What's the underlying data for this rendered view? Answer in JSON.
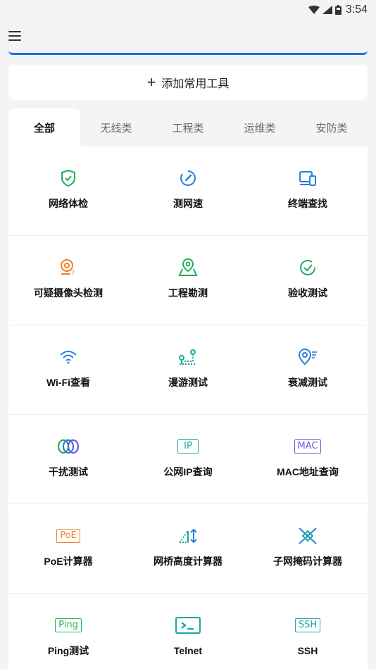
{
  "status_bar": {
    "time": "3:54"
  },
  "add_tool": {
    "plus": "+",
    "label": "添加常用工具"
  },
  "tabs": [
    {
      "label": "全部"
    },
    {
      "label": "无线类"
    },
    {
      "label": "工程类"
    },
    {
      "label": "运维类"
    },
    {
      "label": "安防类"
    }
  ],
  "tools": [
    {
      "label": "网络体检",
      "icon": "shield-check-icon"
    },
    {
      "label": "测网速",
      "icon": "speedometer-icon"
    },
    {
      "label": "终端查找",
      "icon": "device-search-icon"
    },
    {
      "label": "可疑摄像头检测",
      "icon": "camera-question-icon"
    },
    {
      "label": "工程勘测",
      "icon": "location-survey-icon"
    },
    {
      "label": "验收测试",
      "icon": "check-circle-icon"
    },
    {
      "label": "Wi-Fi查看",
      "icon": "wifi-icon"
    },
    {
      "label": "漫游测试",
      "icon": "roaming-icon"
    },
    {
      "label": "衰减测试",
      "icon": "attenuation-icon"
    },
    {
      "label": "干扰测试",
      "icon": "interference-icon"
    },
    {
      "label": "公网IP查询",
      "icon": "ip-box-icon",
      "badge": "IP"
    },
    {
      "label": "MAC地址查询",
      "icon": "mac-box-icon",
      "badge": "MAC"
    },
    {
      "label": "PoE计算器",
      "icon": "poe-box-icon",
      "badge": "PoE"
    },
    {
      "label": "网桥高度计算器",
      "icon": "bridge-height-icon"
    },
    {
      "label": "子网掩码计算器",
      "icon": "subnet-mask-icon"
    },
    {
      "label": "Ping测试",
      "icon": "ping-box-icon",
      "badge": "Ping"
    },
    {
      "label": "Telnet",
      "icon": "terminal-icon"
    },
    {
      "label": "SSH",
      "icon": "ssh-box-icon",
      "badge": "SSH"
    }
  ],
  "colors": {
    "accent": "#1e6fd8",
    "green": "#1fae5b",
    "blue": "#2a7de1",
    "orange": "#f0802a",
    "purple": "#6b5bd6",
    "teal": "#1aa7a0"
  }
}
